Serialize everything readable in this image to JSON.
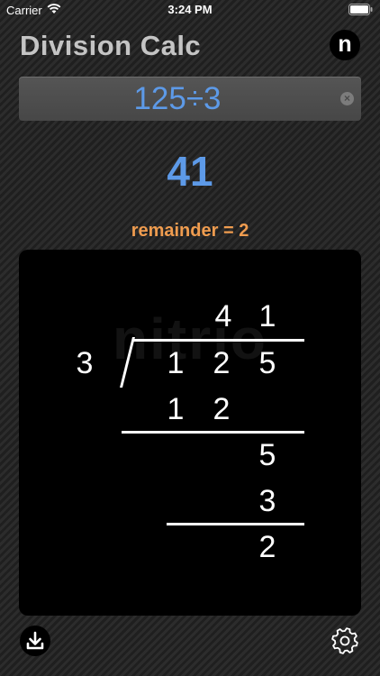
{
  "status_bar": {
    "carrier": "Carrier",
    "time": "3:24 PM"
  },
  "header": {
    "title": "Division Calc",
    "n_button_label": "n"
  },
  "input": {
    "expression": "125÷3"
  },
  "result": {
    "quotient": "41",
    "remainder_text": "remainder = 2"
  },
  "long_division": {
    "divisor": "3",
    "dividend_digits": [
      "1",
      "2",
      "5"
    ],
    "quotient_digits": [
      "4",
      "1"
    ],
    "steps": [
      {
        "product_digits": [
          "1",
          "2"
        ]
      },
      {
        "bring_down": "5",
        "product": "3",
        "remainder": "2"
      }
    ]
  },
  "watermark": "nitrio",
  "icons": {
    "wifi": "wifi-icon",
    "battery": "battery-icon",
    "clear": "clear-icon",
    "download": "download-icon",
    "settings": "gear-icon"
  },
  "colors": {
    "accent_blue": "#5d9ae8",
    "remainder_orange": "#ef9c4f",
    "title_gray": "#c4c4c4"
  }
}
